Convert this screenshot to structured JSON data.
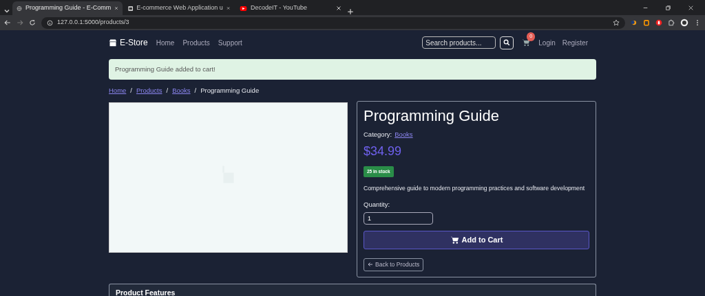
{
  "browser": {
    "tabs": [
      {
        "title": "Programming Guide - E-Comm",
        "selected": true
      },
      {
        "title": "E-commerce Web Application u",
        "selected": false
      },
      {
        "title": "DecodeIT - YouTube",
        "selected": false
      }
    ],
    "url": "127.0.0.1:5000/products/3"
  },
  "navbar": {
    "brand": "E-Store",
    "links": [
      "Home",
      "Products",
      "Support"
    ],
    "search": {
      "placeholder": "Search products..."
    },
    "cart_count": "0",
    "auth_links": [
      "Login",
      "Register"
    ]
  },
  "alert": {
    "message": "Programming Guide added to cart!"
  },
  "breadcrumb": {
    "separator": "/",
    "items": [
      {
        "label": "Home",
        "link": true
      },
      {
        "label": "Products",
        "link": true
      },
      {
        "label": "Books",
        "link": true
      },
      {
        "label": "Programming Guide",
        "link": false
      }
    ]
  },
  "product": {
    "title": "Programming Guide",
    "category_label": "Category:",
    "category": "Books",
    "price": "$34.99",
    "stock": "25 in stock",
    "description": "Comprehensive guide to modern programming practices and software development",
    "quantity_label": "Quantity:",
    "quantity": "1",
    "add_button": "Add to Cart",
    "back_button": "Back to Products"
  },
  "features": {
    "title": "Product Features"
  }
}
